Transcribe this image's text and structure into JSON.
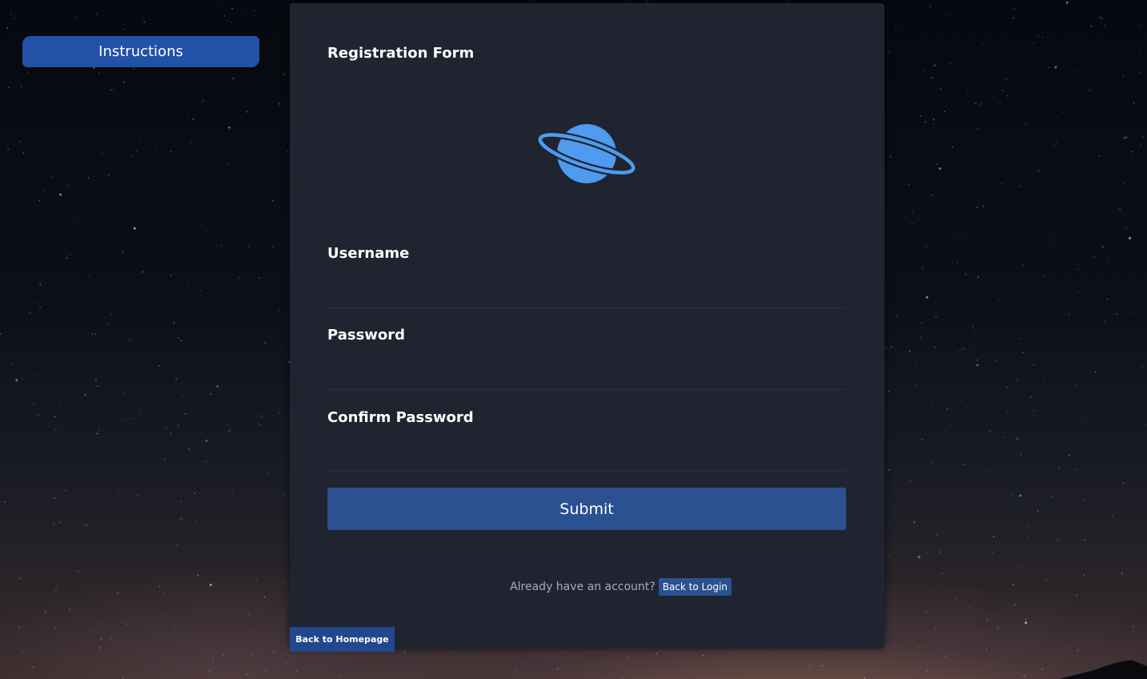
{
  "sidebar": {
    "instructions_label": "Instructions"
  },
  "form": {
    "title": "Registration Form",
    "logo_icon": "planet-icon",
    "fields": [
      {
        "label": "Username",
        "value": "",
        "type": "text"
      },
      {
        "label": "Password",
        "value": "",
        "type": "password"
      },
      {
        "label": "Confirm Password",
        "value": "",
        "type": "password"
      }
    ],
    "submit_label": "Submit",
    "login_prompt": "Already have an account?",
    "login_button": "Back to Login",
    "homepage_button": "Back to Homepage"
  },
  "colors": {
    "card_bg": "#1f2430",
    "accent": "#2c5190",
    "instructions_bg": "#2251a8",
    "planet": "#4f9bef",
    "text": "#ffffff",
    "muted_text": "#a9adb6"
  }
}
